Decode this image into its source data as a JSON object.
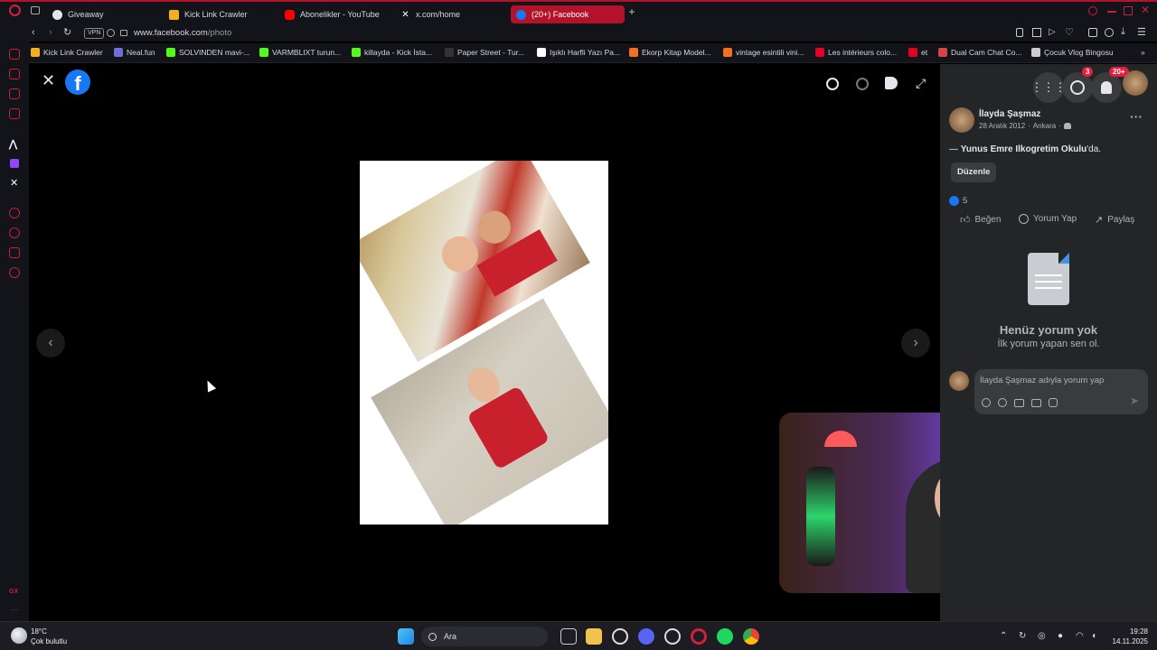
{
  "tabs": [
    {
      "label": "Giveaway",
      "color": "#e4e6eb"
    },
    {
      "label": "Kick Link Crawler",
      "color": "#f2b01e"
    },
    {
      "label": "Abonelikler - YouTube",
      "color": "#ff0000"
    },
    {
      "label": "x.com/home",
      "color": "#ffffff"
    },
    {
      "label": "(20+) Facebook",
      "color": "#1877f2"
    }
  ],
  "address": {
    "vpn": "VPN",
    "domain": "www.facebook.com",
    "path": "/photo"
  },
  "bookmarks": [
    {
      "label": "Kick Link Crawler",
      "color": "#f2b01e"
    },
    {
      "label": "Neal.fun",
      "color": "#6f6fd6"
    },
    {
      "label": "SOLVINDEN mavi-...",
      "color": "#53fc18"
    },
    {
      "label": "VARMBLIXT turun...",
      "color": "#53fc18"
    },
    {
      "label": "killayda - Kick İsta...",
      "color": "#53fc18"
    },
    {
      "label": "Paper Street - Tur...",
      "color": "#333333"
    },
    {
      "label": "Işıklı Harfli Yazı Pa...",
      "color": "#ffffff"
    },
    {
      "label": "Ekorp Kitap Model...",
      "color": "#f37021"
    },
    {
      "label": "vintage esintili vini...",
      "color": "#f37021"
    },
    {
      "label": "Les intérieurs colo...",
      "color": "#e60023"
    },
    {
      "label": "et",
      "color": "#e60023"
    },
    {
      "label": "Dual Cam Chat Co...",
      "color": "#d64545"
    },
    {
      "label": "Çocuk Vlog Bingosu",
      "color": "#cccccc"
    }
  ],
  "post": {
    "author": "İlayda Şaşmaz",
    "date": "28 Aralık 2012",
    "separator": "·",
    "location": "Ankara",
    "place_prefix": "— ",
    "place": "Yunus Emre Ilkogretim Okulu",
    "place_suffix": "'da.",
    "edit_label": "Düzenle",
    "reaction_count": "5",
    "like_label": "Beğen",
    "comment_label": "Yorum Yap",
    "share_label": "Paylaş",
    "empty_title": "Henüz yorum yok",
    "empty_subtitle": "İlk yorum yapan sen ol.",
    "comment_placeholder": "İlayda Şaşmaz adıyla yorum yap"
  },
  "header_badges": {
    "messenger": "3",
    "notifications": "20+"
  },
  "weather": {
    "temp": "18°C",
    "desc": "Çok bulutlu"
  },
  "search": {
    "placeholder": "Ara"
  },
  "clock": {
    "time": "19:28",
    "date": "14.11.2025"
  },
  "sidebar_bottom": "GX",
  "colors": {
    "accent": "#b3132a",
    "fb_blue": "#1877f2",
    "panel": "#242526"
  }
}
